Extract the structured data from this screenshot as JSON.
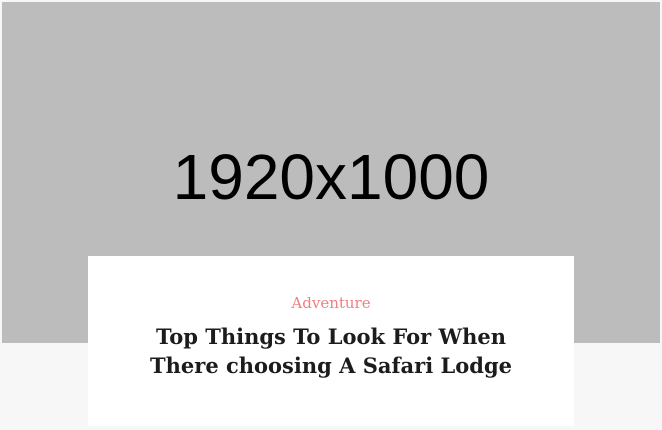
{
  "hero": {
    "image_label": "1920x1000"
  },
  "post": {
    "category": "Adventure",
    "title": "Top Things To Look For When There choosing A Safari Lodge"
  },
  "colors": {
    "image_placeholder": "#bcbcbc",
    "category_accent": "#f08080",
    "title_text": "#1c1c1c",
    "page_background": "#f7f7f7"
  }
}
